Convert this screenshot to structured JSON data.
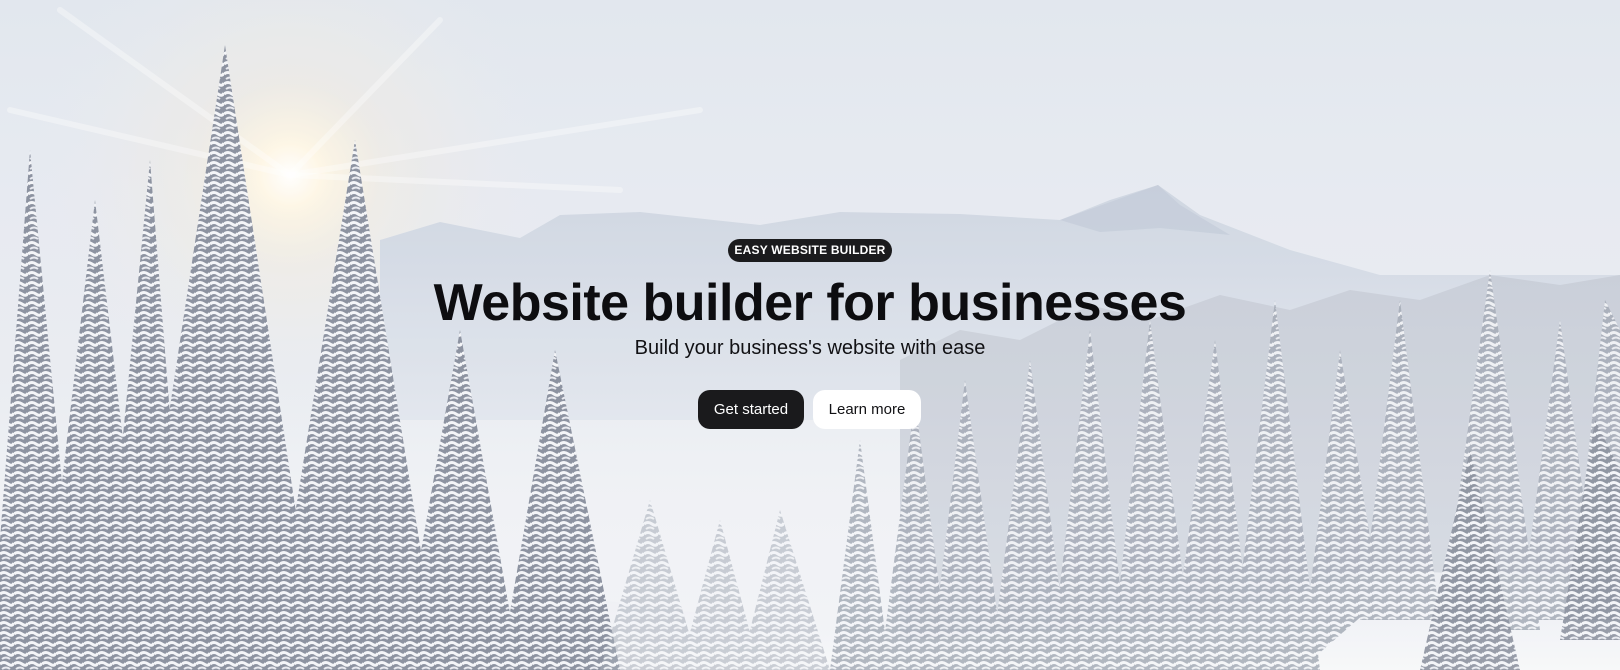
{
  "hero": {
    "badge": "EASY WEBSITE BUILDER",
    "title": "Website builder for businesses",
    "subtitle": "Build your business's website with ease",
    "primary_button": "Get started",
    "secondary_button": "Learn more",
    "background": "snowy-forest-mountain-photo"
  },
  "colors": {
    "button_dark": "#1a1a1c",
    "button_light": "#ffffff",
    "text": "#0d0d10"
  }
}
